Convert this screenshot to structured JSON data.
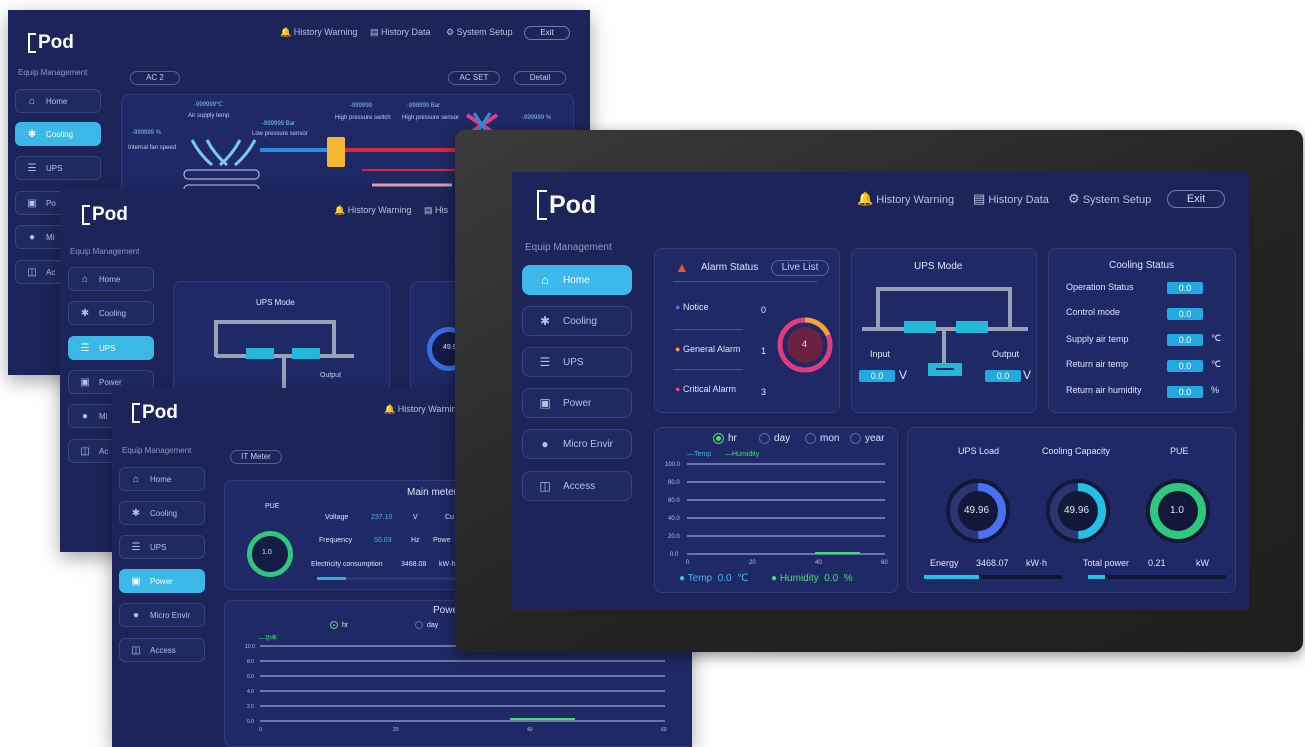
{
  "app": {
    "logo_text": "Pod",
    "equip_label": "Equip Management"
  },
  "topbar": {
    "history_warning": "History Warning",
    "history_data": "History Data",
    "system_setup": "System Setup",
    "exit": "Exit"
  },
  "nav": {
    "home": "Home",
    "cooling": "Cooling",
    "ups": "UPS",
    "power": "Power",
    "micro_envir": "Micro Envir",
    "access": "Access"
  },
  "screen_cooling": {
    "tab": "AC 2",
    "ac_set": "AC SET",
    "detail": "Detail",
    "placeholder": "-999999",
    "air_supply_temp": "Air supply temp",
    "internal_fan_speed": "Internal fan speed",
    "low_pressure_sensor": "Low pressure sensor",
    "high_pressure_switch": "High pressure switch",
    "high_pressure_sensor": "High pressure sensor",
    "unit_bar": "Bar",
    "unit_c": "℃",
    "unit_pct": "%"
  },
  "screen_ups": {
    "ups_mode": "UPS Mode",
    "input": "Input",
    "output": "Output",
    "gauge_value": "49.9"
  },
  "screen_power": {
    "tab": "IT Meter",
    "pue_label": "PUE",
    "pue_value": "1.0",
    "main_meter": "Main meter",
    "voltage_label": "Voltage",
    "voltage_value": "237.10",
    "voltage_unit": "V",
    "frequency_label": "Frequency",
    "frequency_value": "50.03",
    "frequency_unit": "Hz",
    "consumption_label": "Electricity consumption",
    "consumption_value": "3468.08",
    "consumption_unit": "kW·h",
    "cur_trunc": "Cu",
    "power_trunc": "Powe",
    "power_panel_title": "Powe",
    "radio_hr": "hr",
    "radio_day": "day",
    "series_label": "—功率",
    "y_ticks": [
      "10.0",
      "8.0",
      "6.0",
      "4.0",
      "2.0",
      "0.0"
    ],
    "x_ticks": [
      "0",
      "20",
      "40",
      "60"
    ]
  },
  "home": {
    "alarm": {
      "title": "Alarm Status",
      "live_list": "Live List",
      "notice_label": "Notice",
      "notice_count": "0",
      "general_label": "General Alarm",
      "general_count": "1",
      "critical_label": "Critical Alarm",
      "critical_count": "3",
      "total": "4"
    },
    "ups_mode": {
      "title": "UPS Mode",
      "input_label": "Input",
      "output_label": "Output",
      "input_value": "0.0",
      "output_value": "0.0",
      "unit": "V"
    },
    "cooling_status": {
      "title": "Cooling Status",
      "rows": [
        {
          "label": "Operation Status",
          "value": "0.0",
          "unit": ""
        },
        {
          "label": "Control mode",
          "value": "0.0",
          "unit": ""
        },
        {
          "label": "Supply air temp",
          "value": "0.0",
          "unit": "℃"
        },
        {
          "label": "Return air temp",
          "value": "0.0",
          "unit": "℃"
        },
        {
          "label": "Return air humidity",
          "value": "0.0",
          "unit": "%"
        }
      ]
    },
    "trend": {
      "radios": [
        "hr",
        "day",
        "mon",
        "year"
      ],
      "selected": "hr",
      "legend_temp": "—Temp",
      "legend_humidity": "—Humidity",
      "y_ticks": [
        "100.0",
        "80.0",
        "60.0",
        "40.0",
        "20.0",
        "0.0"
      ],
      "x_ticks": [
        "0",
        "20",
        "40",
        "60"
      ],
      "temp_label": "Temp",
      "temp_value": "0.0",
      "temp_unit": "℃",
      "humidity_label": "Humidity",
      "humidity_value": "0.0",
      "humidity_unit": "%"
    },
    "gauges": {
      "ups_load_label": "UPS Load",
      "ups_load_value": "49.96",
      "cooling_capacity_label": "Cooling Capacity",
      "cooling_capacity_value": "49.96",
      "pue_label": "PUE",
      "pue_value": "1.0",
      "energy_label": "Energy",
      "energy_value": "3468.07",
      "energy_unit": "kW·h",
      "total_power_label": "Total power",
      "total_power_value": "0.21",
      "total_power_unit": "kW"
    }
  },
  "colors": {
    "bg": "#1c2459",
    "panel": "#1f2965",
    "accent": "#3cb9ea",
    "green": "#3de06e",
    "warning": "#e8572e"
  }
}
